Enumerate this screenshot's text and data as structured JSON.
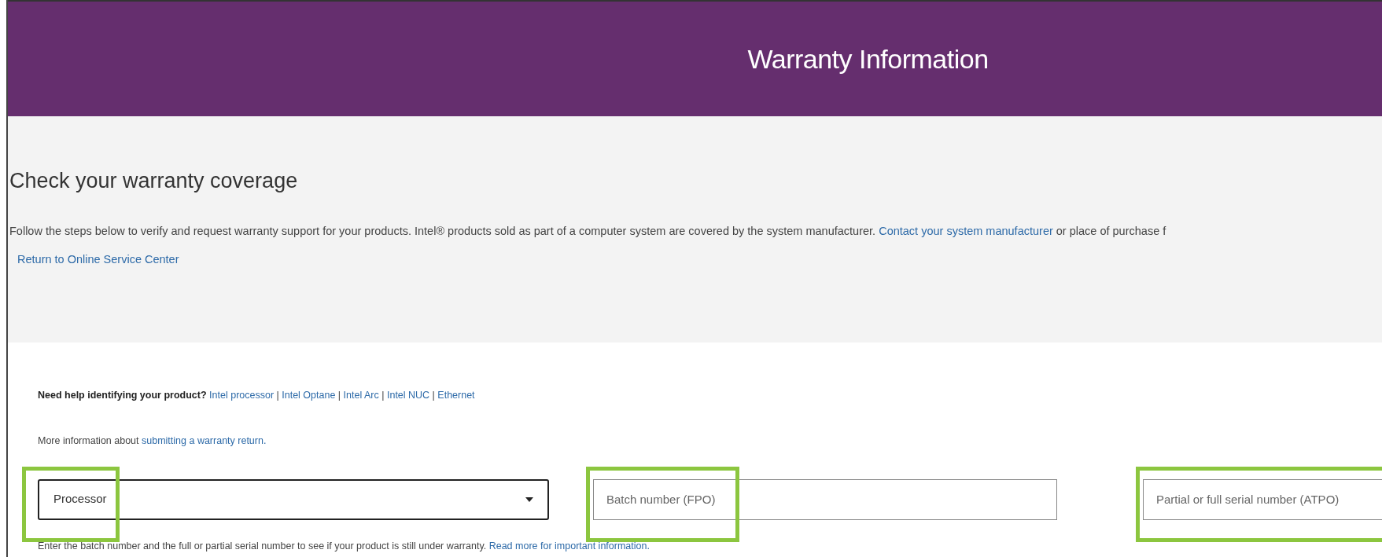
{
  "header": {
    "title": "Warranty Information"
  },
  "intro": {
    "heading": "Check your warranty coverage",
    "text_parts": [
      {
        "kind": "text",
        "text": "Follow the steps below to verify and request warranty support for your products. Intel® products sold as part of a computer system are covered by the system manufacturer. "
      },
      {
        "kind": "link",
        "text": "Contact your system manufacturer"
      },
      {
        "kind": "text",
        "text": " or place of purchase f"
      }
    ],
    "return_link": "Return to Online Service Center"
  },
  "help": {
    "label": "Need help identifying your product?",
    "links": [
      "Intel processor",
      "Intel Optane",
      "Intel Arc",
      "Intel NUC",
      "Ethernet"
    ],
    "separator": "|"
  },
  "more_info": {
    "text": "More information about ",
    "link": "submitting a warranty return."
  },
  "fields": [
    {
      "kind": "select",
      "value": "Processor",
      "highlighted": true
    },
    {
      "kind": "input",
      "placeholder": "Batch number (FPO)",
      "highlighted": true
    },
    {
      "kind": "input",
      "placeholder": "Partial or full serial number (ATPO)",
      "highlighted": true
    }
  ],
  "note": {
    "text": "Enter the batch number and the full or partial serial number to see if your product is still under warranty. ",
    "link": "Read more for important information."
  }
}
